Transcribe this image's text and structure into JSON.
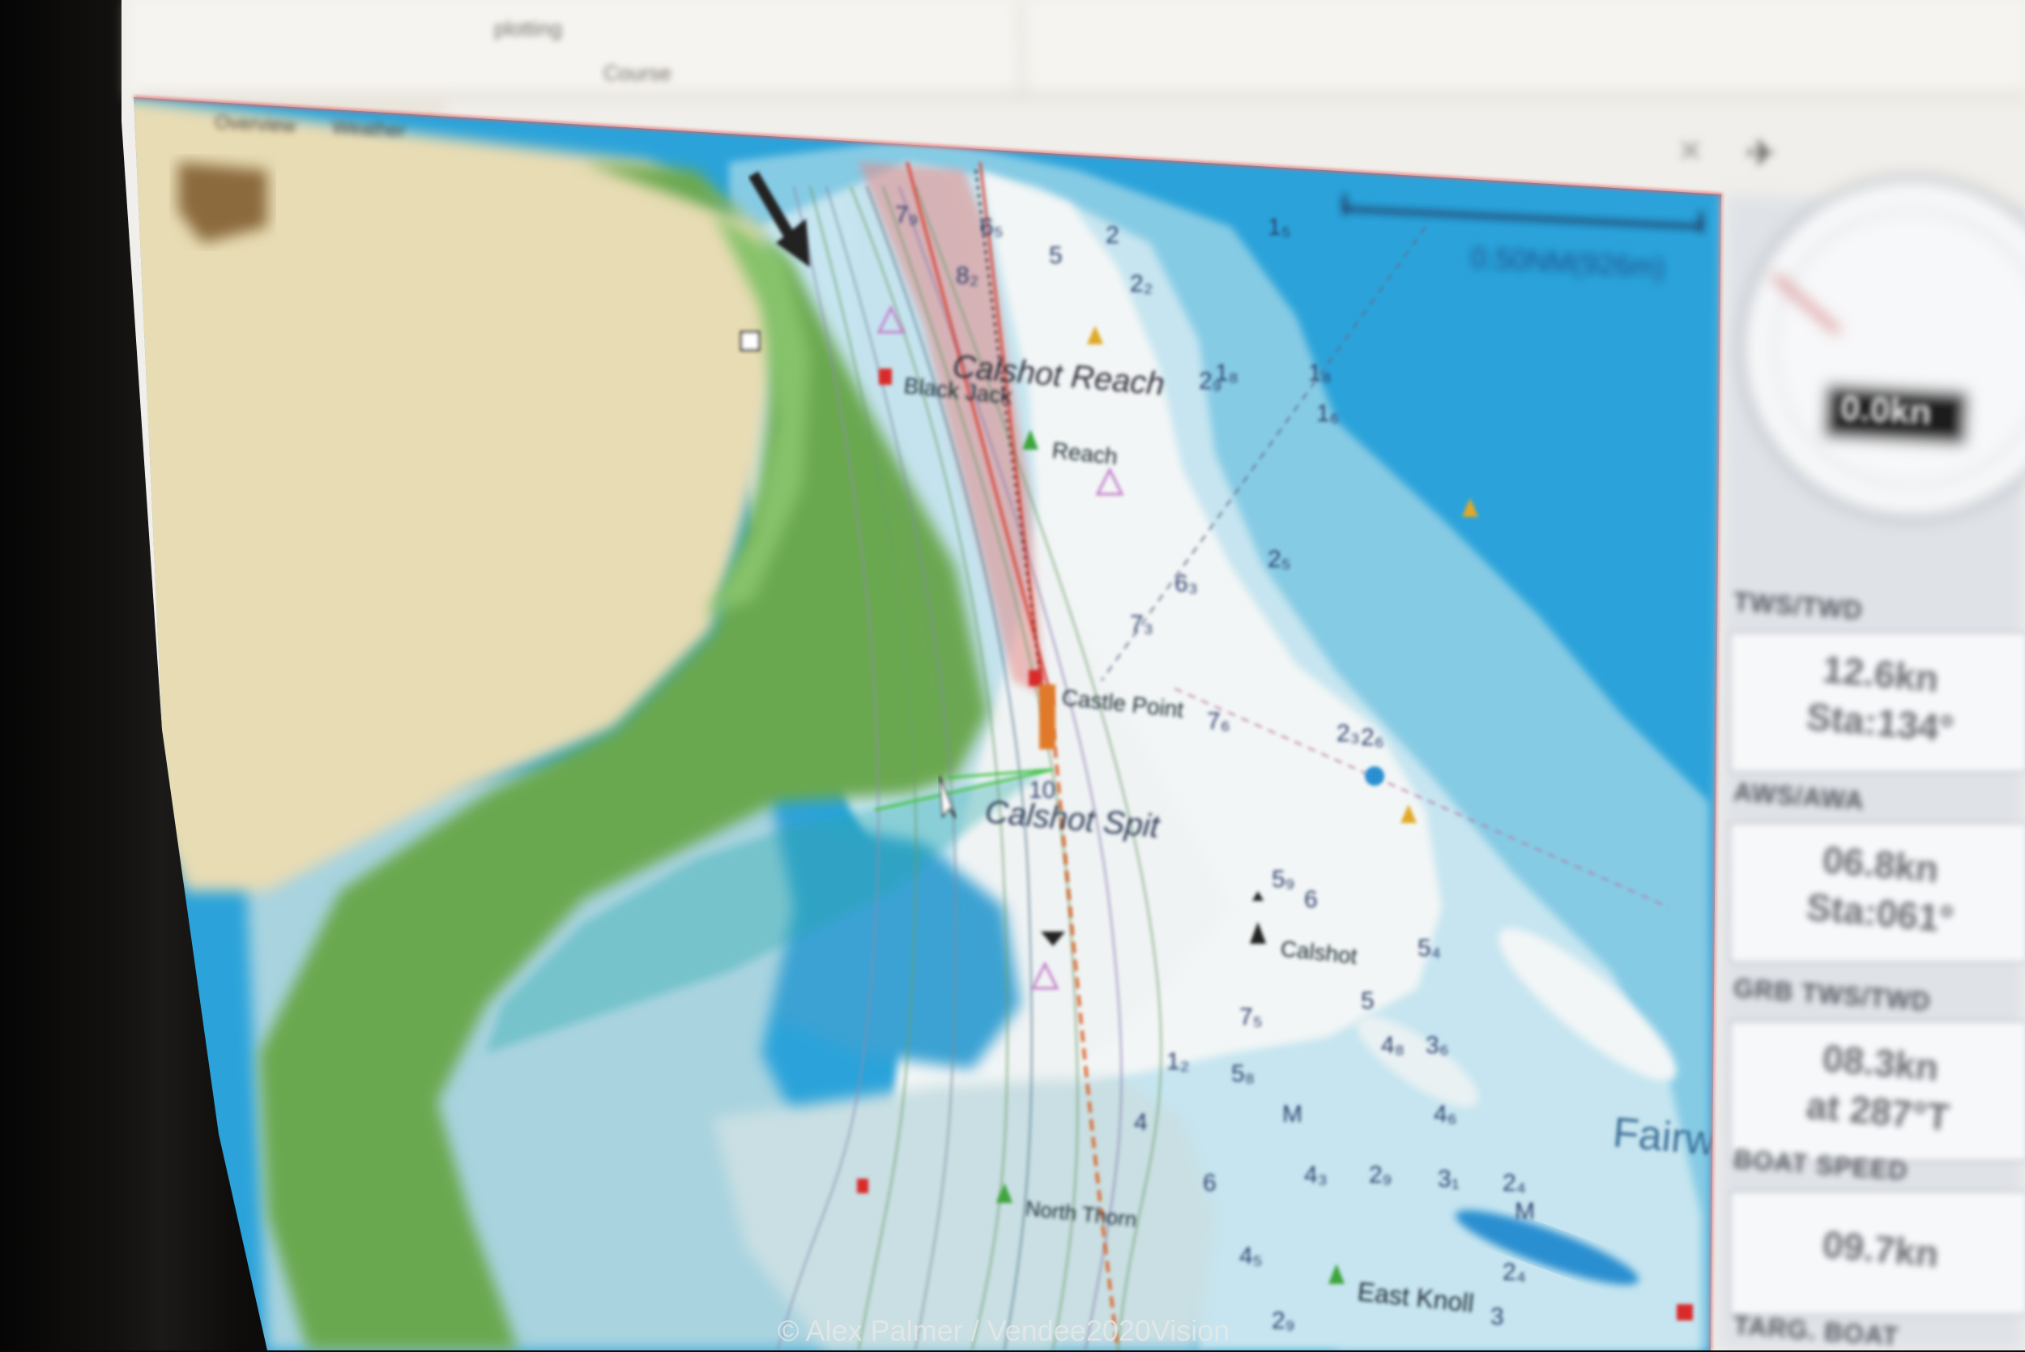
{
  "ribbon": {
    "labels": [
      "Course"
    ],
    "small": [
      "plotting"
    ]
  },
  "tabs": [
    "Overview",
    "Weather"
  ],
  "chart": {
    "scale_text": "0.50NM(926m)",
    "place_names": [
      "Calshot Reach",
      "Calshot Spit",
      "Fairway"
    ],
    "buoys": [
      "Black Jack",
      "Reach",
      "Castle Point",
      "Calshot",
      "North Thorn",
      "East Knoll"
    ],
    "depth_soundings": [
      "7₉",
      "6₅",
      "8₂",
      "5",
      "2",
      "2₂",
      "2₉",
      "1₅",
      "1₈",
      "7₃",
      "7₆",
      "6₃",
      "2₅",
      "1₈",
      "1₆",
      "2₆",
      "2₃",
      "5₉",
      "6",
      "5",
      "5₄",
      "3₆",
      "4₆",
      "4₈",
      "4₃",
      "2₉",
      "3₁",
      "2₄",
      "3",
      "2₄",
      "7₅",
      "5₈",
      "1₂",
      "4",
      "6",
      "4₅",
      "2₉",
      "10",
      "M",
      "M"
    ],
    "colors": {
      "land": "#e8dcb4",
      "green_land": "#6aa84f",
      "shallow": "#c5e4ef",
      "medium": "#7fc6e0",
      "deep": "#2aa0d8",
      "white_water": "#f2f6f7",
      "route": "#d94a3d"
    }
  },
  "instruments": {
    "compass_readout": "0.0kn",
    "sections": [
      {
        "title": "TWS/TWD",
        "line1": "12.6kn",
        "line2": "Sta:134°"
      },
      {
        "title": "AWS/AWA",
        "line1": "06.8kn",
        "line2": "Sta:061°"
      },
      {
        "title": "GRB TWS/TWD",
        "line1": "08.3kn",
        "line2": "at 287°T"
      },
      {
        "title": "BOAT SPEED",
        "line1": "09.7kn",
        "line2": ""
      },
      {
        "title": "TARG. BOAT",
        "line1": "",
        "line2": ""
      }
    ]
  },
  "credit": "© Alex Palmer / Vendee2020Vision"
}
